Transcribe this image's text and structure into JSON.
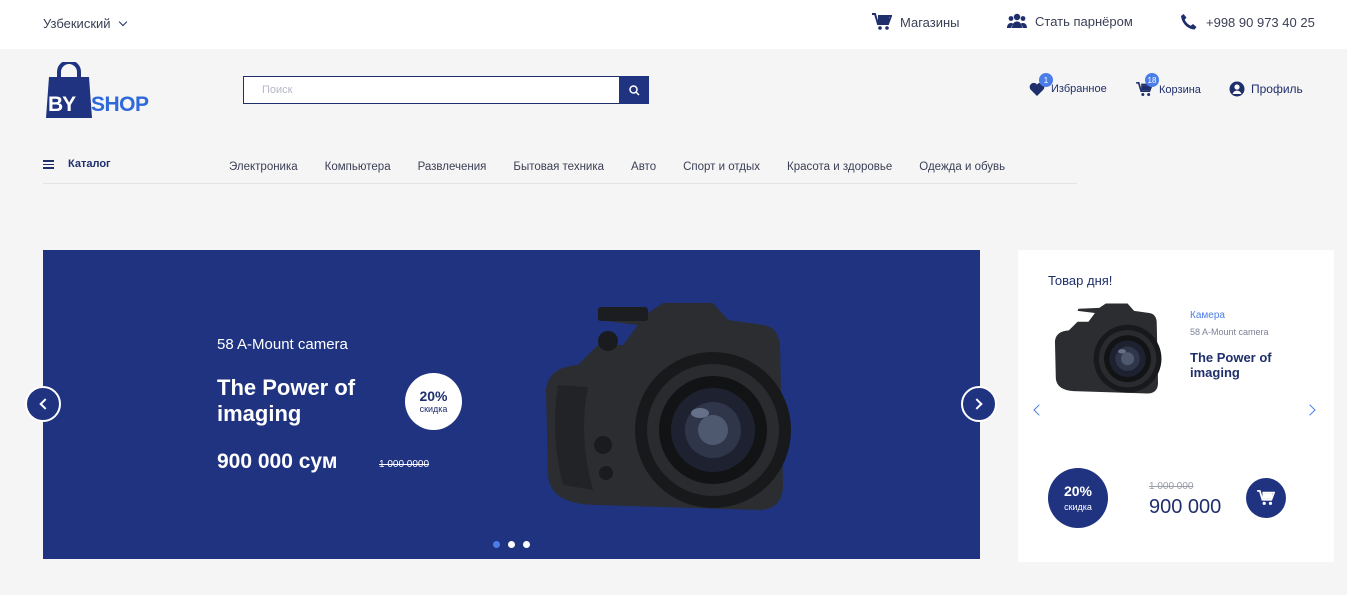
{
  "topbar": {
    "language": "Узбекиский",
    "stores": "Магазины",
    "partner": "Стать парнёром",
    "phone": "+998 90 973 40 25"
  },
  "logo": {
    "by": "BY",
    "shop": "SHOP"
  },
  "search": {
    "placeholder": "Поиск"
  },
  "header": {
    "favorites": {
      "label": "Избранное",
      "count": "1"
    },
    "cart": {
      "label": "Корзина",
      "count": "18"
    },
    "profile": "Профиль"
  },
  "catalog": {
    "label": "Каталог"
  },
  "nav": [
    "Электроника",
    "Компьютера",
    "Развлечения",
    "Бытовая техника",
    "Авто",
    "Спорт и отдых",
    "Красота и здоровье",
    "Одежда и обувь"
  ],
  "banner": {
    "subtitle": "58 A-Mount camera",
    "title": "The Power of imaging",
    "discount_percent": "20%",
    "discount_label": "скидка",
    "price": "900 000 сум",
    "old_price": "1 000 0000",
    "slides": 3,
    "active_slide": 1
  },
  "deal": {
    "title": "Товар дня!",
    "category": "Камера",
    "model": "58 A-Mount camera",
    "name": "The Power of imaging",
    "discount_percent": "20%",
    "discount_label": "скидка",
    "old_price": "1 000 000",
    "price": "900 000"
  },
  "colors": {
    "primary": "#1f3380",
    "accent": "#4a7de8",
    "background": "#f5f5f5"
  },
  "icons": [
    "chevron-down-icon",
    "cart-icon",
    "users-icon",
    "phone-icon",
    "bag-icon",
    "search-icon",
    "heart-icon",
    "user-icon",
    "menu-icon",
    "chevron-left-icon",
    "chevron-right-icon",
    "camera-image"
  ]
}
